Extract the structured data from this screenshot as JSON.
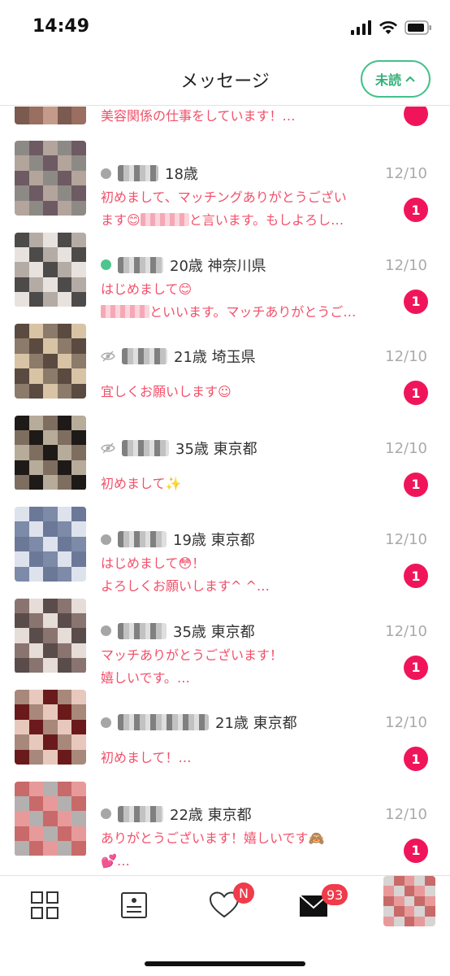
{
  "status": {
    "time": "14:49"
  },
  "header": {
    "title": "メッセージ",
    "unread_label": "未読"
  },
  "partial_top": {
    "preview": "美容関係の仕事をしています！…"
  },
  "messages": [
    {
      "status": "offline",
      "profile": "18歳",
      "date": "12/10",
      "line1": "初めまして、マッチングありがとうござい",
      "line2_pre": "ます😊",
      "line2_post": "と言います。もしよろし…",
      "badge": "1"
    },
    {
      "status": "online",
      "profile": "20歳 神奈川県",
      "date": "12/10",
      "line1": "はじめまして😊",
      "line2_pre": "",
      "line2_post": "といいます。マッチありがとうご…",
      "badge": "1"
    },
    {
      "status": "hidden",
      "profile": "21歳 埼玉県",
      "date": "12/10",
      "line1": "宜しくお願いします☺",
      "badge": "1"
    },
    {
      "status": "hidden",
      "profile": "35歳 東京都",
      "date": "12/10",
      "line1": "初めまして✨",
      "badge": "1"
    },
    {
      "status": "offline",
      "profile": "19歳 東京都",
      "date": "12/10",
      "line1": "はじめまして😳！",
      "line2": "よろしくお願いします^ ^…",
      "badge": "1"
    },
    {
      "status": "offline",
      "profile": "35歳 東京都",
      "date": "12/10",
      "line1": "マッチありがとうございます！",
      "line2": "嬉しいです。…",
      "badge": "1"
    },
    {
      "status": "offline",
      "profile": "21歳 東京都",
      "date": "12/10",
      "line1": "初めまして！…",
      "badge": "1"
    },
    {
      "status": "offline",
      "profile": "22歳 東京都",
      "date": "12/10",
      "line1": "ありがとうございます！嬉しいです🙈",
      "line2": "💕…",
      "badge": "1"
    }
  ],
  "tabbar": {
    "likes_badge": "N",
    "messages_badge": "93",
    "icons": [
      "grid-icon",
      "profile-list-icon",
      "heart-icon",
      "mail-icon",
      "avatar"
    ]
  },
  "colors": {
    "accent_green": "#44c08b",
    "message_pink": "#f2506a",
    "badge_red": "#f0155a"
  }
}
